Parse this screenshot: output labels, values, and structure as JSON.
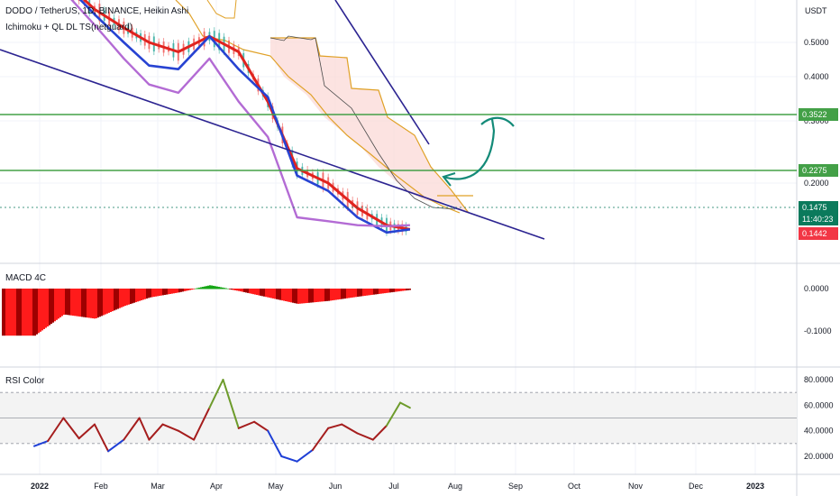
{
  "header": {
    "symbol": "DODO / TetherUS, 1D, BINANCE, Heikin Ashi",
    "study": "Ichimoku + QL DL TS(netguard)",
    "currency": "USDT"
  },
  "colors": {
    "resistance": "#43a047",
    "trendline": "#2c2491",
    "arrow": "#138a78",
    "red_line": "#e0231e",
    "blue_line": "#2743d2",
    "purple_line": "#b36bd4",
    "orange_line": "#e0a127",
    "cloud_fill": "#fbd7d4",
    "macd_red": "#ff1b1b",
    "macd_dark": "#9e0000",
    "macd_green": "#16a616",
    "rsi_red": "#a51d1d",
    "rsi_blue": "#1e3fd6",
    "rsi_green": "#6d9b2b",
    "rsi_pink": "#ee3fe5",
    "price_tag": "#0b7a5c",
    "low_tag": "#f23645"
  },
  "price_scale": {
    "labels": [
      "0.5000",
      "0.4000",
      "0.3000",
      "0.2000"
    ],
    "resistance_tags": [
      "0.3522",
      "0.2275"
    ],
    "last_price": "0.1475",
    "countdown": "11:40:23",
    "low_price": "0.1442"
  },
  "macd_panel": {
    "title": "MACD 4C",
    "labels": [
      "0.0000",
      "-0.1000"
    ]
  },
  "rsi_panel": {
    "title": "RSI Color",
    "labels": [
      "80.0000",
      "60.0000",
      "40.0000",
      "20.0000"
    ]
  },
  "x_axis": {
    "labels": [
      "2022",
      "Feb",
      "Mar",
      "Apr",
      "May",
      "Jun",
      "Jul",
      "Aug",
      "Sep",
      "Oct",
      "Nov",
      "Dec",
      "2023"
    ]
  },
  "chart_data": [
    {
      "type": "line",
      "title": "DODO / TetherUS, 1D, BINANCE, Heikin Ashi",
      "y_scale": "log",
      "x": [
        "2022-01-01",
        "2022-01-16",
        "2022-02-01",
        "2022-02-16",
        "2022-03-01",
        "2022-03-16",
        "2022-04-01",
        "2022-04-16",
        "2022-05-01",
        "2022-05-16",
        "2022-06-01",
        "2022-06-16",
        "2022-07-01",
        "2022-07-13"
      ],
      "series": [
        {
          "values": [
            0.95,
            0.75,
            0.62,
            0.55,
            0.5,
            0.47,
            0.52,
            0.47,
            0.34,
            0.22,
            0.2,
            0.17,
            0.152,
            0.148
          ]
        },
        {
          "values": [
            0.95,
            0.74,
            0.6,
            0.5,
            0.43,
            0.42,
            0.52,
            0.42,
            0.35,
            0.21,
            0.19,
            0.16,
            0.145,
            0.148
          ]
        },
        {
          "values": [
            0.85,
            0.7,
            0.56,
            0.45,
            0.38,
            0.36,
            0.45,
            0.34,
            0.27,
            0.16,
            0.156,
            0.152,
            0.151,
            0.152
          ]
        }
      ],
      "horizontal_levels": [
        0.3522,
        0.2275
      ],
      "last_price": 0.1475,
      "low_price": 0.1442
    },
    {
      "type": "bar",
      "title": "MACD 4C",
      "x": [
        "2022-01-01",
        "2022-01-16",
        "2022-02-01",
        "2022-02-16",
        "2022-03-01",
        "2022-03-16",
        "2022-04-01",
        "2022-04-16",
        "2022-05-01",
        "2022-05-16",
        "2022-06-01",
        "2022-06-16",
        "2022-07-01",
        "2022-07-13"
      ],
      "values": [
        -0.11,
        -0.06,
        -0.07,
        -0.04,
        -0.02,
        -0.008,
        0.008,
        -0.005,
        -0.02,
        -0.035,
        -0.028,
        -0.018,
        -0.009,
        -0.002
      ]
    },
    {
      "type": "line",
      "title": "RSI Color",
      "ylim": [
        15,
        85
      ],
      "levels": [
        70,
        50,
        30
      ],
      "x": [
        "2022-01-01",
        "2022-01-08",
        "2022-01-16",
        "2022-01-24",
        "2022-02-01",
        "2022-02-08",
        "2022-02-16",
        "2022-02-24",
        "2022-03-01",
        "2022-03-08",
        "2022-03-16",
        "2022-03-24",
        "2022-04-01",
        "2022-04-08",
        "2022-04-16",
        "2022-04-24",
        "2022-05-01",
        "2022-05-08",
        "2022-05-16",
        "2022-05-24",
        "2022-06-01",
        "2022-06-08",
        "2022-06-16",
        "2022-06-24",
        "2022-07-01",
        "2022-07-08",
        "2022-07-13"
      ],
      "values": [
        28,
        32,
        50,
        34,
        45,
        24,
        33,
        50,
        33,
        45,
        40,
        33,
        58,
        80,
        42,
        47,
        40,
        20,
        16,
        25,
        42,
        45,
        38,
        33,
        44,
        62,
        58
      ]
    }
  ]
}
